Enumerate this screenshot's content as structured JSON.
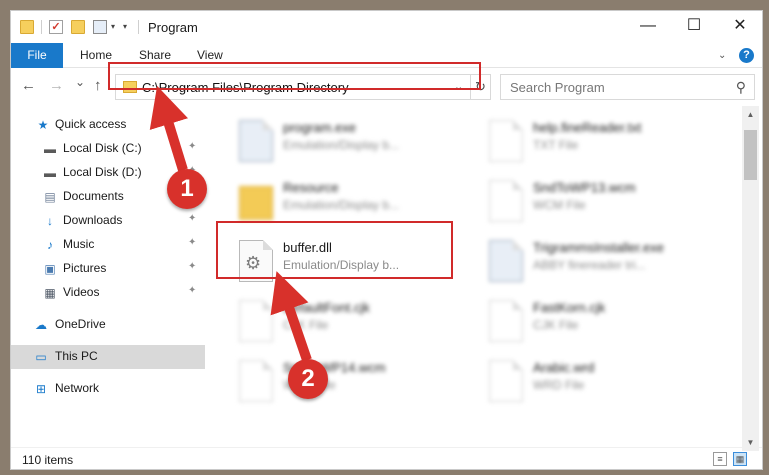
{
  "window": {
    "title": "Program",
    "minimize": "—",
    "maximize": "☐",
    "close": "✕"
  },
  "ribbon": {
    "tabs": [
      "File",
      "Home",
      "Share",
      "View"
    ],
    "help": "?"
  },
  "nav": {
    "back": "←",
    "forward": "→",
    "recent": "⌄",
    "up": "↑",
    "address": "C:\\Program Files\\Program Directory",
    "dropdown": "⌄",
    "refresh": "↻",
    "search_placeholder": "Search Program",
    "search_icon": "⚲"
  },
  "sidebar": {
    "items": [
      {
        "label": "Quick access",
        "icon": "star-icon",
        "glyph": "★",
        "color": "#1979ca",
        "pinned": false
      },
      {
        "label": "Local Disk (C:)",
        "icon": "drive-icon",
        "glyph": "▬",
        "color": "#5a5a5a",
        "pinned": true
      },
      {
        "label": "Local Disk (D:)",
        "icon": "drive-icon",
        "glyph": "▬",
        "color": "#5a5a5a",
        "pinned": true
      },
      {
        "label": "Documents",
        "icon": "documents-icon",
        "glyph": "▤",
        "color": "#6d7e96",
        "pinned": true
      },
      {
        "label": "Downloads",
        "icon": "download-icon",
        "glyph": "↓",
        "color": "#1979ca",
        "pinned": true
      },
      {
        "label": "Music",
        "icon": "music-icon",
        "glyph": "♪",
        "color": "#1979ca",
        "pinned": true
      },
      {
        "label": "Pictures",
        "icon": "pictures-icon",
        "glyph": "▣",
        "color": "#4b7bb0",
        "pinned": true
      },
      {
        "label": "Videos",
        "icon": "videos-icon",
        "glyph": "▦",
        "color": "#4b5563",
        "pinned": true
      },
      {
        "label": "OneDrive",
        "icon": "cloud-icon",
        "glyph": "☁",
        "color": "#1979ca",
        "pinned": false
      },
      {
        "label": "This PC",
        "icon": "computer-icon",
        "glyph": "▭",
        "color": "#1979ca",
        "pinned": false
      },
      {
        "label": "Network",
        "icon": "network-icon",
        "glyph": "⊞",
        "color": "#1979ca",
        "pinned": false
      }
    ],
    "pin_glyph": "📌"
  },
  "files": [
    {
      "name": "program.exe",
      "desc": "Emulation/Display b...",
      "type": "exe",
      "blurred": true
    },
    {
      "name": "help.fineReader.txt",
      "desc": "TXT File",
      "type": "doc",
      "blurred": true
    },
    {
      "name": "Resource",
      "desc": "Emulation/Display b...",
      "type": "folder",
      "blurred": true
    },
    {
      "name": "SndToWP13.wcm",
      "desc": "WCM File",
      "type": "doc",
      "blurred": true
    },
    {
      "name": "buffer.dll",
      "desc": "Emulation/Display b...",
      "type": "dll",
      "blurred": false
    },
    {
      "name": "TrigrammsInstaller.exe",
      "desc": "ABBY finereader tri...",
      "type": "exe",
      "blurred": true
    },
    {
      "name": "DefaultFont.cjk",
      "desc": "CJK File",
      "type": "doc",
      "blurred": true
    },
    {
      "name": "FastKorn.cjk",
      "desc": "CJK File",
      "type": "doc",
      "blurred": true
    },
    {
      "name": "SndToWP14.wcm",
      "desc": "WCM File",
      "type": "doc",
      "blurred": true
    },
    {
      "name": "Arabic.wrd",
      "desc": "WRD File",
      "type": "doc",
      "blurred": true
    }
  ],
  "status": {
    "count": "110 items"
  },
  "annotations": {
    "step1": "1",
    "step2": "2",
    "highlight_color": "#d12a2a"
  }
}
